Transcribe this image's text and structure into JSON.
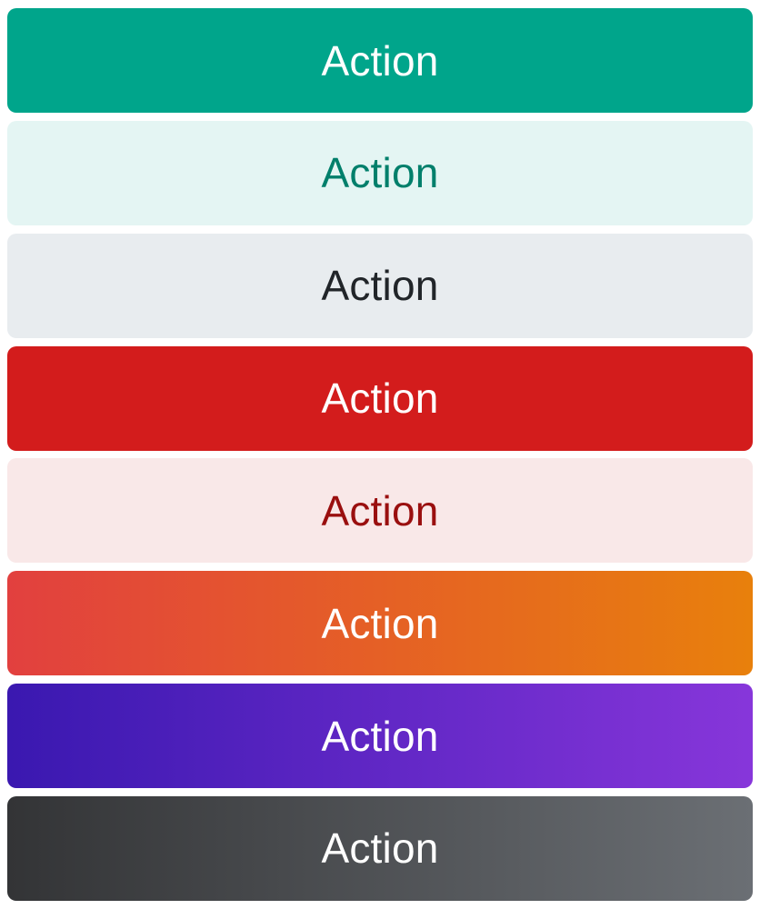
{
  "buttons": [
    {
      "label": "Action",
      "variant": "primary",
      "color": "#00a58b"
    },
    {
      "label": "Action",
      "variant": "primary-soft",
      "color": "#e4f5f3"
    },
    {
      "label": "Action",
      "variant": "neutral",
      "color": "#e8ecef"
    },
    {
      "label": "Action",
      "variant": "danger",
      "color": "#d31c1c"
    },
    {
      "label": "Action",
      "variant": "danger-soft",
      "color": "#f9e8e8"
    },
    {
      "label": "Action",
      "variant": "sunset-gradient",
      "color": "#e2403f-#e8800c"
    },
    {
      "label": "Action",
      "variant": "violet-gradient",
      "color": "#3a18b0-#8736da"
    },
    {
      "label": "Action",
      "variant": "graphite-gradient",
      "color": "#333436-#6b6f74"
    }
  ]
}
